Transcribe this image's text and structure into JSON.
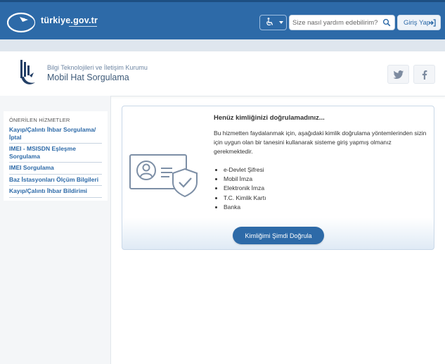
{
  "topbar": {
    "logo_text": "türkiye.gov.tr",
    "search_placeholder": "Size nasıl yardım edebilirim?",
    "login_label": "Giriş Yap",
    "icons": {
      "accessibility": "wheelchair-icon",
      "search": "search-icon",
      "login": "sign-in-icon"
    }
  },
  "header": {
    "org_name": "Bilgi Teknolojileri ve İletişim Kurumu",
    "page_title": "Mobil Hat Sorgulama",
    "social": [
      "twitter-icon",
      "facebook-icon"
    ]
  },
  "sidebar": {
    "heading": "ÖNERİLEN HİZMETLER",
    "items": [
      "Kayıp/Çalıntı İhbar Sorgulama/İptal",
      "IMEI - MSISDN Eşleşme Sorgulama",
      "IMEI Sorgulama",
      "Baz İstasyonları Ölçüm Bilgileri",
      "Kayıp/Çalıntı İhbar Bildirimi"
    ]
  },
  "card": {
    "title": "Henüz kimliğinizi doğrulamadınız...",
    "description": "Bu hizmetten faydalanmak için, aşağıdaki kimlik doğrulama yöntemlerinden sizin için uygun olan bir tanesini kullanarak sisteme giriş yapmış olmanız gerekmektedir.",
    "methods": [
      "e-Devlet Şifresi",
      "Mobil İmza",
      "Elektronik İmza",
      "T.C. Kimlik Kartı",
      "Banka"
    ],
    "button_label": "Kimliğimi Şimdi Doğrula"
  },
  "colors": {
    "primary": "#2d6aa8",
    "illustration": "#7d8fa6"
  }
}
